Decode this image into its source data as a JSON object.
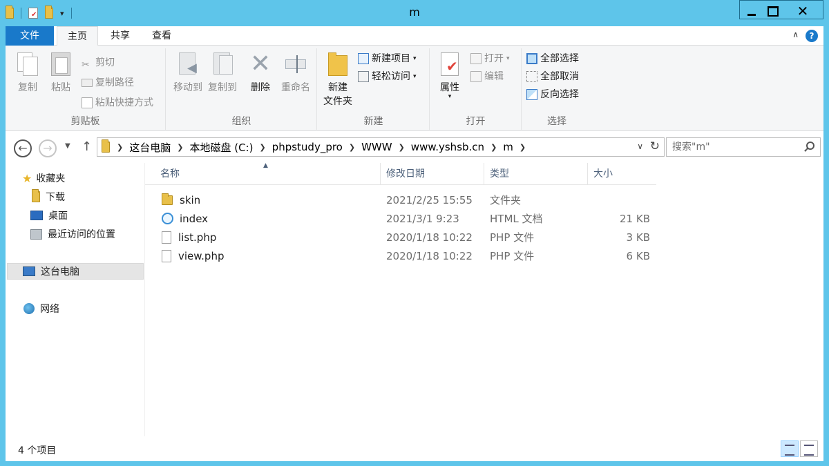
{
  "window": {
    "title": "m"
  },
  "quick_access": {
    "dropdown_glyph": "▾"
  },
  "ribbon_tabs": [
    "文件",
    "主页",
    "共享",
    "查看"
  ],
  "ribbon": {
    "clipboard": {
      "label": "剪贴板",
      "copy": "复制",
      "paste": "粘贴",
      "cut": "剪切",
      "copy_path": "复制路径",
      "paste_shortcut": "粘贴快捷方式"
    },
    "organize": {
      "label": "组织",
      "move_to": "移动到",
      "copy_to": "复制到",
      "delete": "删除",
      "rename": "重命名"
    },
    "new": {
      "label": "新建",
      "new_folder_line1": "新建",
      "new_folder_line2": "文件夹",
      "new_item": "新建项目",
      "easy_access": "轻松访问"
    },
    "open": {
      "label": "打开",
      "properties": "属性",
      "open": "打开",
      "edit": "编辑"
    },
    "select": {
      "label": "选择",
      "select_all": "全部选择",
      "select_none": "全部取消",
      "invert": "反向选择"
    }
  },
  "address": {
    "crumbs": [
      "这台电脑",
      "本地磁盘 (C:)",
      "phpstudy_pro",
      "WWW",
      "www.yshsb.cn",
      "m"
    ]
  },
  "search": {
    "placeholder": "搜索\"m\""
  },
  "sidebar": {
    "favorites": "收藏夹",
    "downloads": "下载",
    "desktop": "桌面",
    "recent": "最近访问的位置",
    "this_pc": "这台电脑",
    "network": "网络"
  },
  "columns": {
    "name": "名称",
    "date": "修改日期",
    "type": "类型",
    "size": "大小"
  },
  "files": [
    {
      "name": "skin",
      "date": "2021/2/25 15:55",
      "type": "文件夹",
      "size": "",
      "icon": "folder-icon"
    },
    {
      "name": "index",
      "date": "2021/3/1 9:23",
      "type": "HTML 文档",
      "size": "21 KB",
      "icon": "html-file-icon"
    },
    {
      "name": "list.php",
      "date": "2020/1/18 10:22",
      "type": "PHP 文件",
      "size": "3 KB",
      "icon": "file-icon"
    },
    {
      "name": "view.php",
      "date": "2020/1/18 10:22",
      "type": "PHP 文件",
      "size": "6 KB",
      "icon": "file-icon"
    }
  ],
  "status": {
    "item_count": "4 个项目"
  },
  "colors": {
    "frame": "#5ec5ea",
    "file_tab": "#1979ca"
  }
}
